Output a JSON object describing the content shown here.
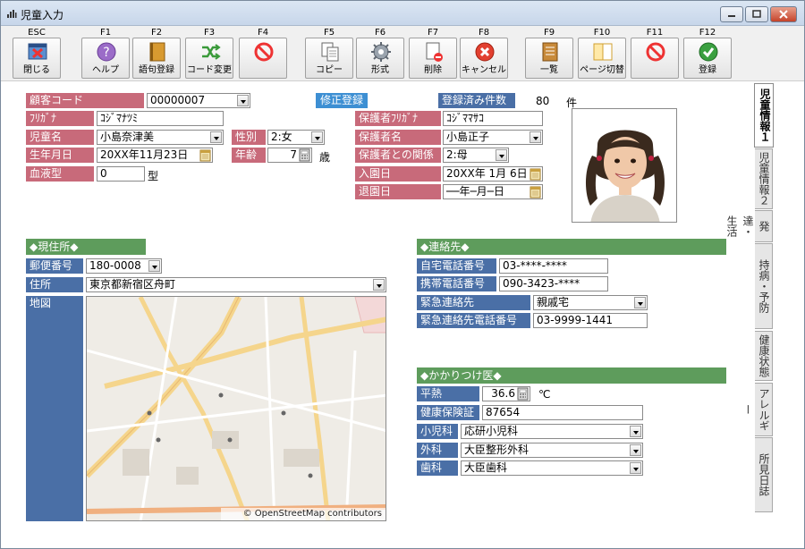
{
  "window": {
    "title": "児童入力"
  },
  "toolbar": [
    {
      "key": "ESC",
      "label": "閉じる",
      "icon": "close-window-icon"
    },
    {
      "key": "F1",
      "label": "ヘルプ",
      "icon": "help-icon"
    },
    {
      "key": "F2",
      "label": "語句登録",
      "icon": "book-icon"
    },
    {
      "key": "F3",
      "label": "コード変更",
      "icon": "shuffle-icon"
    },
    {
      "key": "F4",
      "label": "",
      "icon": "prohibited-icon"
    },
    {
      "key": "F5",
      "label": "コピー",
      "icon": "copy-icon"
    },
    {
      "key": "F6",
      "label": "形式",
      "icon": "gear-icon"
    },
    {
      "key": "F7",
      "label": "削除",
      "icon": "delete-page-icon"
    },
    {
      "key": "F8",
      "label": "キャンセル",
      "icon": "cancel-icon"
    },
    {
      "key": "F9",
      "label": "一覧",
      "icon": "list-book-icon"
    },
    {
      "key": "F10",
      "label": "ページ切替",
      "icon": "page-switch-icon"
    },
    {
      "key": "F11",
      "label": "",
      "icon": "prohibited-icon"
    },
    {
      "key": "F12",
      "label": "登録",
      "icon": "check-icon"
    }
  ],
  "form": {
    "customer_code_label": "顧客コード",
    "customer_code": "00000007",
    "mode_label": "修正登録",
    "registered_count_label": "登録済み件数",
    "registered_count": "80",
    "registered_count_unit": "件",
    "furigana_label": "ﾌﾘｶﾞﾅ",
    "furigana": "ｺｼﾞﾏﾅﾂﾐ",
    "child_name_label": "児童名",
    "child_name": "小島奈津美",
    "gender_label": "性別",
    "gender": "2:女",
    "birthdate_label": "生年月日",
    "birthdate": "20XX年11月23日",
    "age_label": "年齢",
    "age": "7",
    "age_unit": "歳",
    "blood_type_label": "血液型",
    "blood_type": "0",
    "blood_type_unit": "型",
    "guardian_furigana_label": "保護者ﾌﾘｶﾞﾅ",
    "guardian_furigana": "ｺｼﾞﾏﾏｻｺ",
    "guardian_name_label": "保護者名",
    "guardian_name": "小島正子",
    "relation_label": "保護者との関係",
    "relation": "2:母",
    "enroll_label": "入園日",
    "enroll_date": "20XX年 1月 6日",
    "leave_label": "退園日",
    "leave_date": "──年─月─日"
  },
  "address": {
    "section_title": "◆現住所◆",
    "postal_label": "郵便番号",
    "postal": "180-0008",
    "address_label": "住所",
    "address": "東京都新宿区舟町",
    "map_label": "地図",
    "map_credit": "© OpenStreetMap contributors"
  },
  "contact": {
    "section_title": "◆連絡先◆",
    "home_phone_label": "自宅電話番号",
    "home_phone": "03-****-****",
    "mobile_label": "携帯電話番号",
    "mobile": "090-3423-****",
    "emergency_label": "緊急連絡先",
    "emergency": "親戚宅",
    "emergency_phone_label": "緊急連絡先電話番号",
    "emergency_phone": "03-9999-1441"
  },
  "doctor": {
    "section_title": "◆かかりつけ医◆",
    "temp_label": "平熱",
    "temp": "36.6",
    "temp_unit": "℃",
    "insurance_label": "健康保険証",
    "insurance": "87654",
    "pediatrics_label": "小児科",
    "pediatrics": "応研小児科",
    "surgery_label": "外科",
    "surgery": "大臣整形外科",
    "dental_label": "歯科",
    "dental": "大臣歯科"
  },
  "side_tabs": [
    {
      "label": "児童情報１"
    },
    {
      "label": "児童情報２"
    },
    {
      "label": "発達・生活"
    },
    {
      "label": "持病・予防"
    },
    {
      "label": "健康状態"
    },
    {
      "label": "アレルギー"
    },
    {
      "label": "所見日誌"
    }
  ]
}
